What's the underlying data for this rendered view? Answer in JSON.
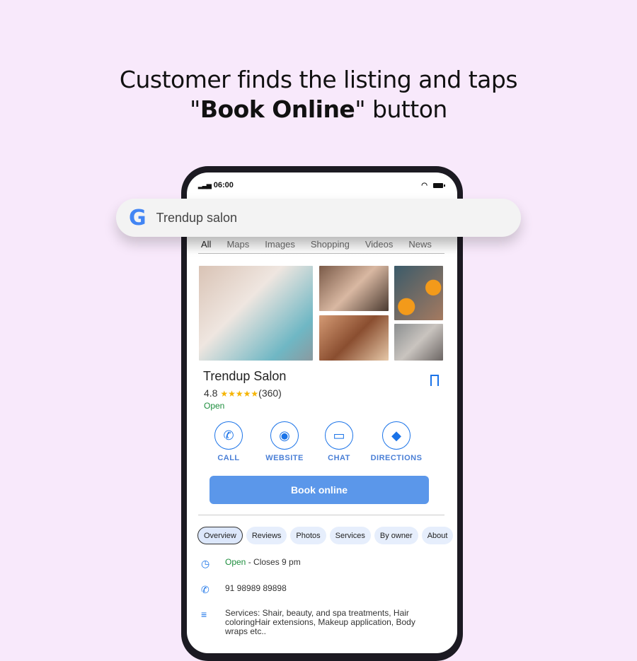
{
  "headline": {
    "line1": "Customer finds the listing and taps",
    "quote_open": "\"",
    "bold": "Book Online",
    "quote_close": "\" button"
  },
  "status": {
    "time": "06:00"
  },
  "search": {
    "query": "Trendup salon"
  },
  "tabs": [
    "All",
    "Maps",
    "Images",
    "Shopping",
    "Videos",
    "News"
  ],
  "listing": {
    "name": "Trendup Salon",
    "rating": "4.8",
    "stars": "★★★★★",
    "reviews": "(360)",
    "status": "Open"
  },
  "actions": [
    {
      "label": "CALL",
      "icon": "phone-icon"
    },
    {
      "label": "WEBSITE",
      "icon": "globe-icon"
    },
    {
      "label": "CHAT",
      "icon": "chat-icon"
    },
    {
      "label": "DIRECTIONS",
      "icon": "directions-icon"
    }
  ],
  "book_label": "Book online",
  "chips": [
    "Overview",
    "Reviews",
    "Photos",
    "Services",
    "By owner",
    "About"
  ],
  "info": {
    "open": "Open",
    "closes": " - Closes 9 pm",
    "phone": "91 98989 89898",
    "services": "Services: Shair, beauty, and spa treatments, Hair coloringHair extensions, Makeup application, Body wraps etc.."
  },
  "colors": {
    "accent": "#1a73e8",
    "button": "#5b97ea",
    "open": "#1e8e3e",
    "background": "#f8e9fb"
  }
}
